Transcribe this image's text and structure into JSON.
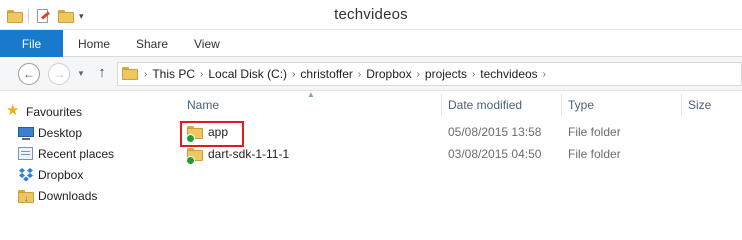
{
  "window": {
    "title": "techvideos"
  },
  "ribbon": {
    "file_label": "File",
    "tabs": [
      {
        "label": "Home"
      },
      {
        "label": "Share"
      },
      {
        "label": "View"
      }
    ]
  },
  "address": {
    "crumbs": [
      "This PC",
      "Local Disk (C:)",
      "christoffer",
      "Dropbox",
      "projects",
      "techvideos"
    ]
  },
  "navpane": {
    "favourites_label": "Favourites",
    "items": [
      {
        "label": "Desktop",
        "icon": "desktop-icon"
      },
      {
        "label": "Recent places",
        "icon": "recent-places-icon"
      },
      {
        "label": "Dropbox",
        "icon": "dropbox-icon"
      },
      {
        "label": "Downloads",
        "icon": "downloads-icon"
      }
    ]
  },
  "filelist": {
    "columns": {
      "name": "Name",
      "date": "Date modified",
      "type": "Type",
      "size": "Size"
    },
    "rows": [
      {
        "name": "app",
        "date": "05/08/2015 13:58",
        "type": "File folder",
        "selected": true
      },
      {
        "name": "dart-sdk-1-11-1",
        "date": "03/08/2015 04:50",
        "type": "File folder",
        "selected": false
      }
    ]
  },
  "colors": {
    "file_tab": "#1979ca",
    "highlight": "#e11b1b",
    "column_header": "#4c607a",
    "folder": "#f0c75e"
  }
}
